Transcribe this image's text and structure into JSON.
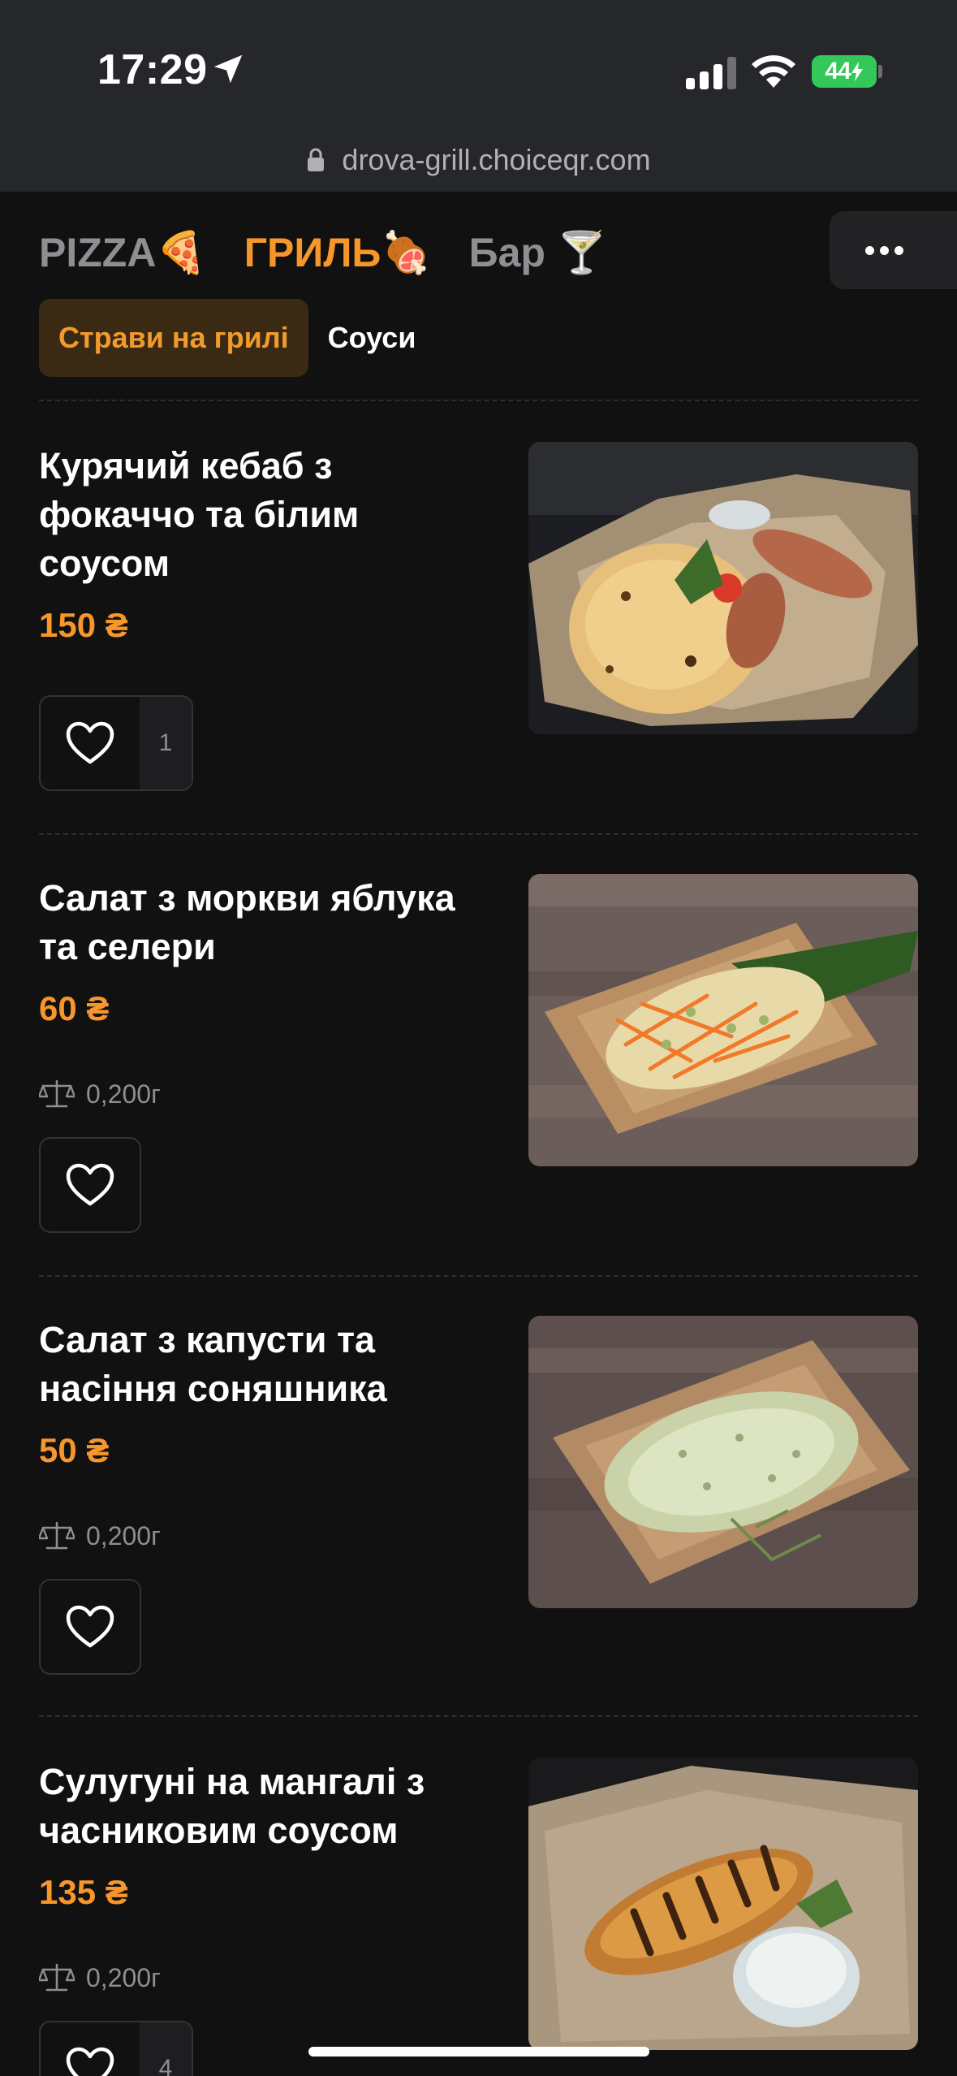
{
  "status_bar": {
    "time": "17:29",
    "battery": "44"
  },
  "browser": {
    "url": "drova-grill.choiceqr.com"
  },
  "categories": [
    {
      "label": "PIZZA🍕",
      "active": false
    },
    {
      "label": "ГРИЛЬ🍖",
      "active": true
    },
    {
      "label": "Бар 🍸",
      "active": false
    }
  ],
  "subcategories": [
    {
      "label": "Страви на грилі",
      "active": true
    },
    {
      "label": "Соуси",
      "active": false
    }
  ],
  "items": [
    {
      "name": "Курячий кебаб з фокаччо та білим соусом",
      "price": "150 ₴",
      "likes": "1"
    },
    {
      "name": "Салат з моркви яблука та селери",
      "price": "60 ₴",
      "weight": "0,200г"
    },
    {
      "name": "Салат з капусти та насіння соняшника",
      "price": "50 ₴",
      "weight": "0,200г"
    },
    {
      "name": "Сулугуні на мангалі з часниковим соусом",
      "price": "135 ₴",
      "weight": "0,200г",
      "likes": "4"
    }
  ],
  "colors": {
    "accent": "#f7962a",
    "background": "#111111",
    "top_bar": "#26272b"
  }
}
